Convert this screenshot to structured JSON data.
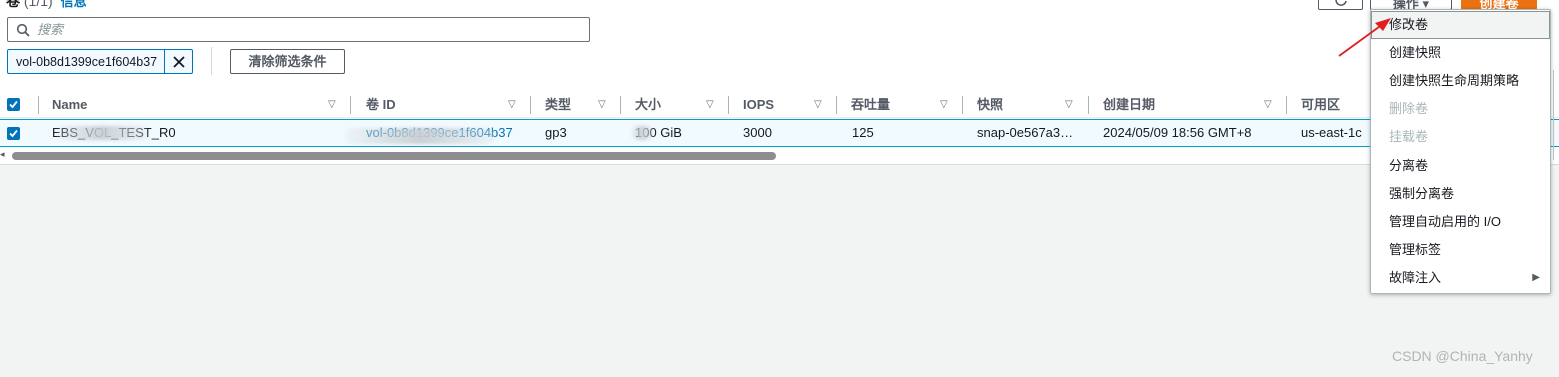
{
  "header": {
    "title": "卷",
    "count": "(1/1)",
    "info_link": "信息",
    "refresh_icon": "refresh-icon",
    "actions_label": "操作",
    "create_label": "创建卷"
  },
  "search": {
    "placeholder": "搜索"
  },
  "filter": {
    "token_text": "vol-0b8d1399ce1f604b37",
    "clear_label": "清除筛选条件"
  },
  "table": {
    "columns": [
      "Name",
      "卷 ID",
      "类型",
      "大小",
      "IOPS",
      "吞吐量",
      "快照",
      "创建日期",
      "可用区"
    ],
    "rows": [
      {
        "name": "EBS_VOL_TEST_R0",
        "volume_id": "vol-0b8d1399ce1f604b37",
        "type": "gp3",
        "size": "100 GiB",
        "iops": "3000",
        "throughput": "125",
        "snapshot": "snap-0e567a3…",
        "created": "2024/05/09 18:56 GMT+8",
        "az": "us-east-1c"
      }
    ]
  },
  "menu": {
    "items": [
      {
        "label": "修改卷",
        "state": "active"
      },
      {
        "label": "创建快照",
        "state": "normal"
      },
      {
        "label": "创建快照生命周期策略",
        "state": "normal"
      },
      {
        "label": "删除卷",
        "state": "disabled"
      },
      {
        "label": "挂载卷",
        "state": "disabled"
      },
      {
        "label": "分离卷",
        "state": "normal"
      },
      {
        "label": "强制分离卷",
        "state": "normal"
      },
      {
        "label": "管理自动启用的 I/O",
        "state": "normal"
      },
      {
        "label": "管理标签",
        "state": "normal"
      },
      {
        "label": "故障注入",
        "state": "normal",
        "submenu": true
      }
    ]
  },
  "watermark": "CSDN @China_Yanhy",
  "colors": {
    "accent": "#0073bb",
    "primary_button": "#ec7211",
    "annotation_arrow": "#e02020"
  }
}
